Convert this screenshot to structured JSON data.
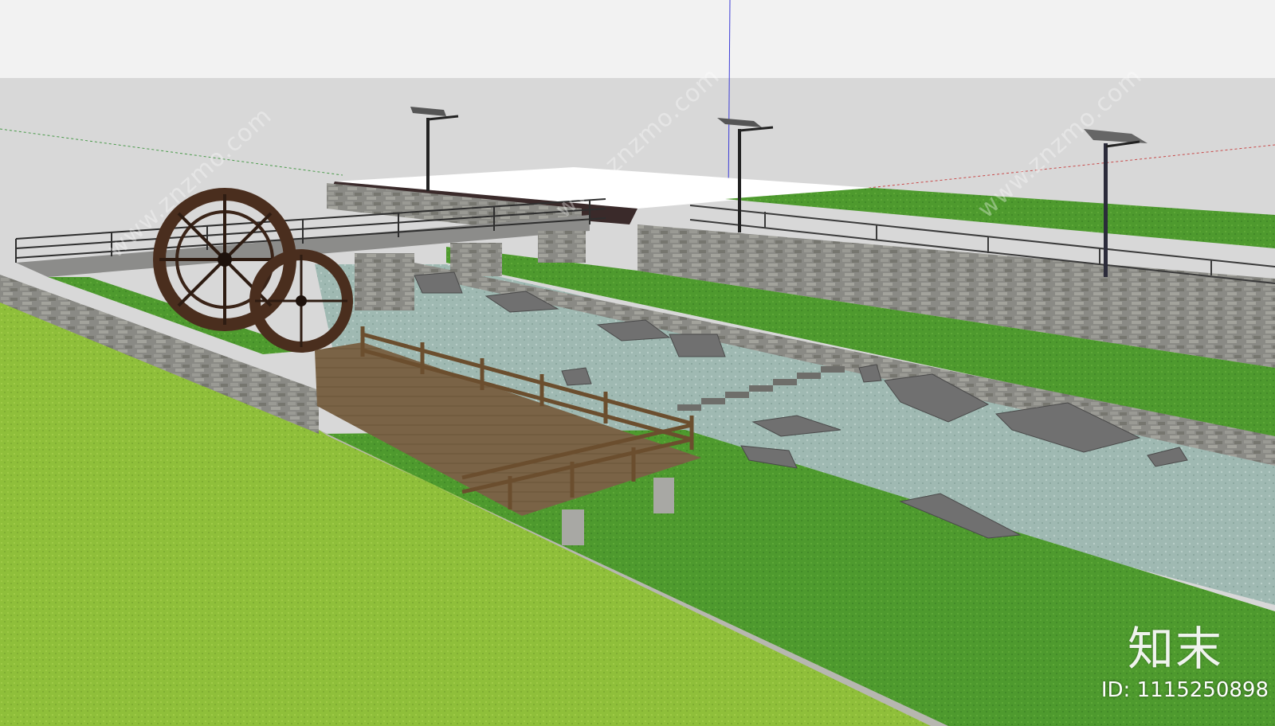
{
  "scene": {
    "subject": "water-wheel-riverside-landscape-model",
    "colors": {
      "sky": "#f2f2f2",
      "ground_plane": "#d8d8d8",
      "lawn_near": "#8fbf3a",
      "lawn_mid": "#4e9a2e",
      "water": "#9fb9b2",
      "stone_wall": "#8a8a85",
      "deck": "#7a6346",
      "wheel": "#4a2e1e",
      "rail": "#2e2e2e"
    }
  },
  "watermark": {
    "brand_logo_text": "知末",
    "image_id": "ID: 1115250898",
    "repeated_text": "www.znzmo.com"
  }
}
